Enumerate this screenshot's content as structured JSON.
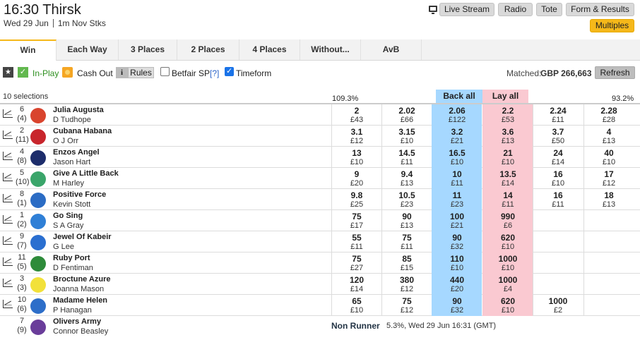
{
  "header": {
    "title": "16:30 Thirsk",
    "date": "Wed 29 Jun",
    "race_type": "1m Nov Stks",
    "buttons": {
      "live_stream": "Live Stream",
      "radio": "Radio",
      "tote": "Tote",
      "form_results": "Form & Results",
      "multiples": "Multiples"
    }
  },
  "tabs": [
    "Win",
    "Each Way",
    "3 Places",
    "2 Places",
    "4 Places",
    "Without...",
    "AvB"
  ],
  "options": {
    "inplay": "In-Play",
    "cashout": "Cash Out",
    "rules": "Rules",
    "betfair_sp": "Betfair SP",
    "help": "[?]",
    "timeform": "Timeform",
    "matched_label": "Matched:",
    "matched_value": "GBP 266,663",
    "refresh": "Refresh"
  },
  "market": {
    "selections": "10 selections",
    "back_overround": "109.3%",
    "lay_overround": "93.2%",
    "back_all": "Back all",
    "lay_all": "Lay all"
  },
  "runners": [
    {
      "no": "6",
      "draw": "(4)",
      "name": "Julia Augusta",
      "jockey": "D Tudhope",
      "silk_color": "#d9442e",
      "prices": [
        [
          "2",
          "£43"
        ],
        [
          "2.02",
          "£66"
        ],
        [
          "2.06",
          "£122"
        ],
        [
          "2.2",
          "£53"
        ],
        [
          "2.24",
          "£11"
        ],
        [
          "2.28",
          "£28"
        ]
      ]
    },
    {
      "no": "2",
      "draw": "(11)",
      "name": "Cubana Habana",
      "jockey": "O J Orr",
      "silk_color": "#c8252c",
      "prices": [
        [
          "3.1",
          "£12"
        ],
        [
          "3.15",
          "£10"
        ],
        [
          "3.2",
          "£21"
        ],
        [
          "3.6",
          "£13"
        ],
        [
          "3.7",
          "£50"
        ],
        [
          "4",
          "£13"
        ]
      ]
    },
    {
      "no": "4",
      "draw": "(8)",
      "name": "Enzos Angel",
      "jockey": "Jason Hart",
      "silk_color": "#1d2d6b",
      "prices": [
        [
          "13",
          "£10"
        ],
        [
          "14.5",
          "£11"
        ],
        [
          "16.5",
          "£10"
        ],
        [
          "21",
          "£10"
        ],
        [
          "24",
          "£14"
        ],
        [
          "40",
          "£10"
        ]
      ]
    },
    {
      "no": "5",
      "draw": "(10)",
      "name": "Give A Little Back",
      "jockey": "M Harley",
      "silk_color": "#3aa56a",
      "prices": [
        [
          "9",
          "£20"
        ],
        [
          "9.4",
          "£13"
        ],
        [
          "10",
          "£11"
        ],
        [
          "13.5",
          "£14"
        ],
        [
          "16",
          "£10"
        ],
        [
          "17",
          "£12"
        ]
      ]
    },
    {
      "no": "8",
      "draw": "(1)",
      "name": "Positive Force",
      "jockey": "Kevin Stott",
      "silk_color": "#2b6cc4",
      "prices": [
        [
          "9.8",
          "£25"
        ],
        [
          "10.5",
          "£23"
        ],
        [
          "11",
          "£23"
        ],
        [
          "14",
          "£11"
        ],
        [
          "16",
          "£11"
        ],
        [
          "18",
          "£13"
        ]
      ]
    },
    {
      "no": "1",
      "draw": "(2)",
      "name": "Go Sing",
      "jockey": "S A Gray",
      "silk_color": "#2f7fd6",
      "prices": [
        [
          "75",
          "£17"
        ],
        [
          "90",
          "£13"
        ],
        [
          "100",
          "£21"
        ],
        [
          "990",
          "£6"
        ],
        [
          "",
          ""
        ],
        [
          "",
          ""
        ]
      ]
    },
    {
      "no": "9",
      "draw": "(7)",
      "name": "Jewel Of Kabeir",
      "jockey": "G Lee",
      "silk_color": "#2a6fd0",
      "prices": [
        [
          "55",
          "£11"
        ],
        [
          "75",
          "£11"
        ],
        [
          "90",
          "£32"
        ],
        [
          "620",
          "£10"
        ],
        [
          "",
          ""
        ],
        [
          "",
          ""
        ]
      ]
    },
    {
      "no": "11",
      "draw": "(5)",
      "name": "Ruby Port",
      "jockey": "D Fentiman",
      "silk_color": "#2e8b3a",
      "prices": [
        [
          "75",
          "£27"
        ],
        [
          "85",
          "£15"
        ],
        [
          "110",
          "£10"
        ],
        [
          "1000",
          "£10"
        ],
        [
          "",
          ""
        ],
        [
          "",
          ""
        ]
      ]
    },
    {
      "no": "3",
      "draw": "(3)",
      "name": "Broctune Azure",
      "jockey": "Joanna Mason",
      "silk_color": "#f2e13a",
      "prices": [
        [
          "120",
          "£14"
        ],
        [
          "380",
          "£12"
        ],
        [
          "440",
          "£20"
        ],
        [
          "1000",
          "£4"
        ],
        [
          "",
          ""
        ],
        [
          "",
          ""
        ]
      ]
    },
    {
      "no": "10",
      "draw": "(6)",
      "name": "Madame Helen",
      "jockey": "P Hanagan",
      "silk_color": "#2d6ec9",
      "prices": [
        [
          "65",
          "£10"
        ],
        [
          "75",
          "£12"
        ],
        [
          "90",
          "£32"
        ],
        [
          "620",
          "£10"
        ],
        [
          "1000",
          "£2"
        ],
        [
          "",
          ""
        ]
      ]
    }
  ],
  "non_runner": {
    "no": "7",
    "draw": "(9)",
    "name": "Olivers Army",
    "jockey": "Connor Beasley",
    "silk_color": "#6a3d9a",
    "label": "Non Runner",
    "info": "5.3%, Wed 29 Jun 16:31 (GMT)"
  }
}
